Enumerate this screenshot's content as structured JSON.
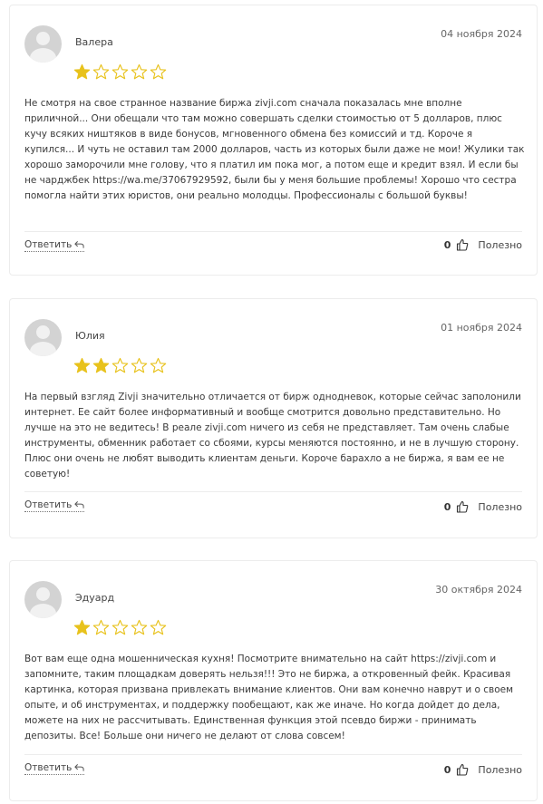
{
  "reviews": [
    {
      "author": "Валера",
      "date": "04 ноября 2024",
      "rating": 1,
      "text": "Не смотря на свое странное название биржа zivji.com сначала показалась мне вполне приличной... Они обещали что там можно совершать сделки стоимостью от 5 долларов, плюс кучу всяких ништяков в виде бонусов, мгновенного обмена без комиссий и тд. Короче я купился... И чуть не оставил там 2000 долларов, часть из которых были даже не мои! Жулики так хорошо заморочили мне голову, что я платил им пока мог, а потом еще и кредит взял. И если бы не чарджбек https://wa.me/37067929592, были бы у меня большие проблемы! Хорошо что сестра помогла найти этих юристов, они реально молодцы. Профессионалы с большой буквы!",
      "reply_label": "Ответить",
      "helpful_count": "0",
      "helpful_label": "Полезно"
    },
    {
      "author": "Юлия",
      "date": "01 ноября 2024",
      "rating": 2,
      "text": "На первый взгляд Zivji значительно отличается от бирж однодневок, которые сейчас заполонили интернет. Ее сайт более информативный и вообще смотрится довольно представительно. Но лучше на это не ведитесь! В реале zivji.com ничего из себя не представляет. Там очень слабые инструменты, обменник работает со сбоями, курсы меняются постоянно, и не в лучшую сторону. Плюс они очень не любят выводить клиентам деньги. Короче барахло а не биржа, я вам ее не советую!",
      "reply_label": "Ответить",
      "helpful_count": "0",
      "helpful_label": "Полезно"
    },
    {
      "author": "Эдуард",
      "date": "30 октября 2024",
      "rating": 1,
      "text": "Вот вам еще одна мошенническая кухня! Посмотрите внимательно на сайт https://zivji.com и запомните, таким площадкам доверять нельзя!!! Это не биржа, а откровенный фейк. Красивая картинка, которая призвана привлекать внимание клиентов. Они вам конечно наврут и о своем опыте, и об инструментах, и поддержку пообещают, как же иначе. Но когда дойдет до дела, можете на них не рассчитывать. Единственная функция этой псевдо биржи - принимать депозиты. Все! Больше они ничего не делают от слова совсем!",
      "reply_label": "Ответить",
      "helpful_count": "0",
      "helpful_label": "Полезно"
    }
  ],
  "max_rating": 5,
  "colors": {
    "star_filled": "#e8c21c",
    "star_empty_stroke": "#e8c21c",
    "border": "#ececec"
  }
}
